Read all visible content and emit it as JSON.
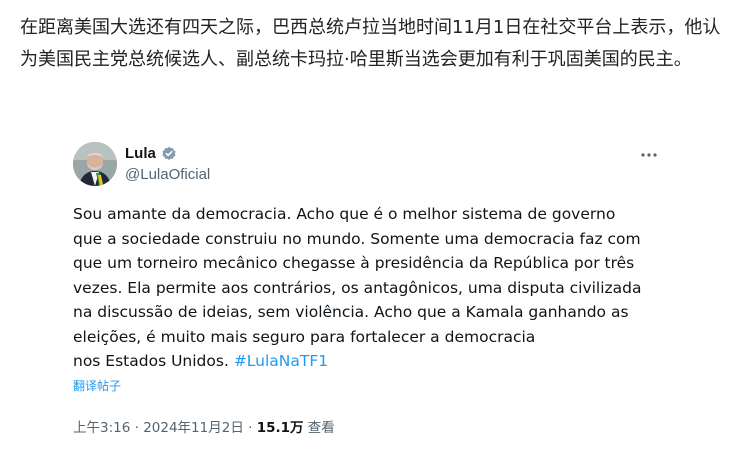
{
  "article": {
    "text": "在距离美国大选还有四天之际，巴西总统卢拉当地时间11月1日在社交平台上表示，他认为美国民主党总统候选人、副总统卡玛拉·哈里斯当选会更加有利于巩固美国的民主。"
  },
  "tweet": {
    "author_name": "Lula",
    "author_handle": "@LulaOficial",
    "verified_icon": "verified-badge-icon",
    "more_icon": "more-horizontal-icon",
    "body_line_1": "Sou amante da democracia. Acho que é o melhor sistema de governo",
    "body_line_2": "que a sociedade construiu no mundo. Somente uma democracia faz com",
    "body_line_3": "que um torneiro mecânico chegasse à presidência da República por três",
    "body_line_4": "vezes. Ela permite aos contrários, os antagônicos, uma disputa civilizada",
    "body_line_5": "na discussão de ideias, sem violência. Acho que a Kamala ganhando as",
    "body_line_6": "eleições, é muito mais seguro para fortalecer a democracia",
    "body_line_7": "nos Estados Unidos. ",
    "hashtag": "#LulaNaTF1",
    "translate_label": "翻译帖子",
    "time": "上午3:16",
    "separator": " · ",
    "date": "2024年11月2日",
    "views_count": "15.1万",
    "views_label": " 查看"
  },
  "colors": {
    "link": "#1d9bf0",
    "secondary_text": "#536471",
    "primary_text": "#0f1419"
  }
}
